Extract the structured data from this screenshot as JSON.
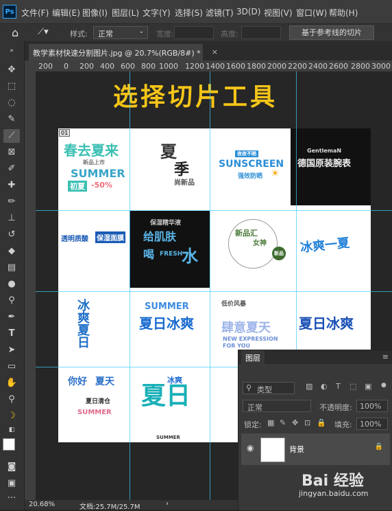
{
  "menu": {
    "app_logo": "Ps",
    "items": [
      "文件(F)",
      "编辑(E)",
      "图像(I)",
      "图层(L)",
      "文字(Y)",
      "选择(S)",
      "滤镜(T)",
      "3D(D)",
      "视图(V)",
      "窗口(W)",
      "帮助(H)"
    ]
  },
  "options": {
    "style_label": "样式:",
    "style_value": "正常",
    "width_label": "宽度:",
    "height_label": "高度:",
    "guide_slice_button": "基于参考线的切片"
  },
  "document": {
    "tab_title": "教学素材快速分割图片.jpg @ 20.7%(RGB/8#) *",
    "close": "×",
    "slice_label": "01",
    "ruler_ticks": [
      "200",
      "0",
      "200",
      "400",
      "600",
      "800",
      "1000",
      "1200",
      "1400",
      "1600",
      "1800",
      "2000",
      "2200",
      "2400",
      "2600",
      "2800",
      "3000"
    ]
  },
  "canvas": {
    "heading": "选择切片工具"
  },
  "grid": {
    "c1": {
      "main": "春去夏来",
      "sub": "新品上市",
      "en": "SUMMER",
      "tag": "初夏",
      "pct": "-50%"
    },
    "c2": {
      "main": "夏",
      "main2": "季",
      "sub": "尚新品"
    },
    "c3": {
      "top": "夜夜不晒",
      "en": "SUNSCREEN",
      "sub": "强效防晒"
    },
    "c4": {
      "en": "GentlemaN",
      "main": "德国原装腕表"
    },
    "c5": {
      "line1": "透明质酸",
      "line2": "保湿面膜"
    },
    "c6": {
      "top": "保湿精华液",
      "main": "给肌肤",
      "main2": "喝",
      "en": "FRESH",
      "water": "水"
    },
    "c7": {
      "main": "新品汇",
      "sub": "女神",
      "badge": "新品"
    },
    "c8": {
      "main": "冰爽一夏"
    },
    "c9": {
      "main": "冰爽夏日"
    },
    "c10": {
      "en": "SUMMER",
      "main": "夏日冰爽"
    },
    "c11": {
      "top": "低价风暴",
      "main": "肆意夏天",
      "en": "NEW EXPRESSION",
      "en2": "FOR YOU"
    },
    "c12": {
      "main": "夏日冰爽"
    },
    "c13": {
      "main": "你好",
      "main2": "夏天",
      "sub": "夏日清仓",
      "en": "SUMMER"
    },
    "c14": {
      "main": "夏日",
      "sub": "冰爽",
      "en": "SUMMER"
    }
  },
  "status": {
    "zoom": "20.68%",
    "doc": "文档:25.7M/25.7M"
  },
  "layers": {
    "tab": "图层",
    "kind_label": "类型",
    "blend_mode": "正常",
    "opacity_label": "不透明度:",
    "opacity_value": "100%",
    "lock_label": "锁定:",
    "fill_label": "填充:",
    "fill_value": "100%",
    "layer_name": "背景"
  },
  "watermark": {
    "main": "Bai 经验",
    "url": "jingyan.baidu.com"
  },
  "colors": {
    "accent": "#31a8ff",
    "guide": "#3fc9ff",
    "heading": "#f5c518"
  }
}
